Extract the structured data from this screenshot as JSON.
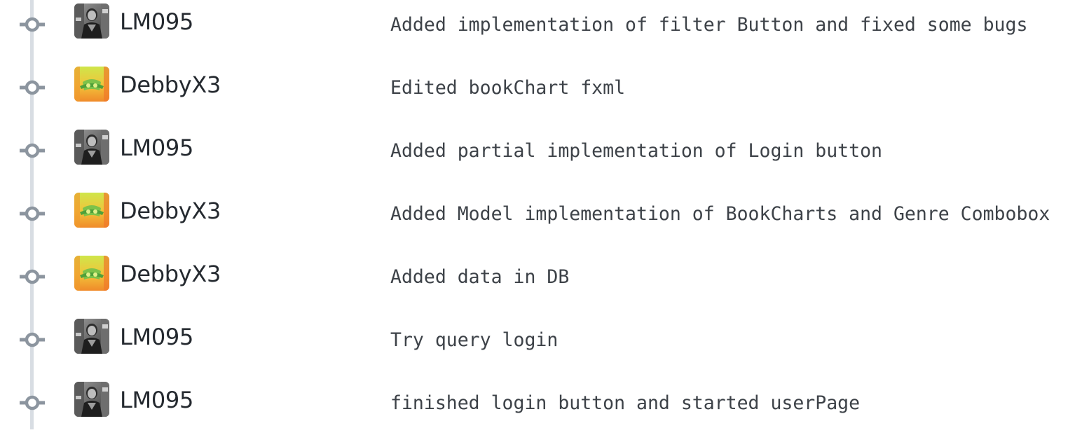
{
  "colors": {
    "timeline": "#d8dde3",
    "commit_dot": "#8c959f",
    "author_text": "#24292f",
    "message_text": "#3d4248"
  },
  "commits": [
    {
      "author": "LM095",
      "avatar": "photo-avatar-lm095",
      "message": "Added implementation of filter Button and fixed some bugs"
    },
    {
      "author": "DebbyX3",
      "avatar": "color-avatar-debbyx3",
      "message": "Edited bookChart fxml"
    },
    {
      "author": "LM095",
      "avatar": "photo-avatar-lm095",
      "message": "Added partial implementation of Login button"
    },
    {
      "author": "DebbyX3",
      "avatar": "color-avatar-debbyx3",
      "message": "Added Model implementation of BookCharts and Genre Combobox"
    },
    {
      "author": "DebbyX3",
      "avatar": "color-avatar-debbyx3",
      "message": "Added data in DB"
    },
    {
      "author": "LM095",
      "avatar": "photo-avatar-lm095",
      "message": "Try query login"
    },
    {
      "author": "LM095",
      "avatar": "photo-avatar-lm095",
      "message": "finished login button and started userPage"
    }
  ]
}
